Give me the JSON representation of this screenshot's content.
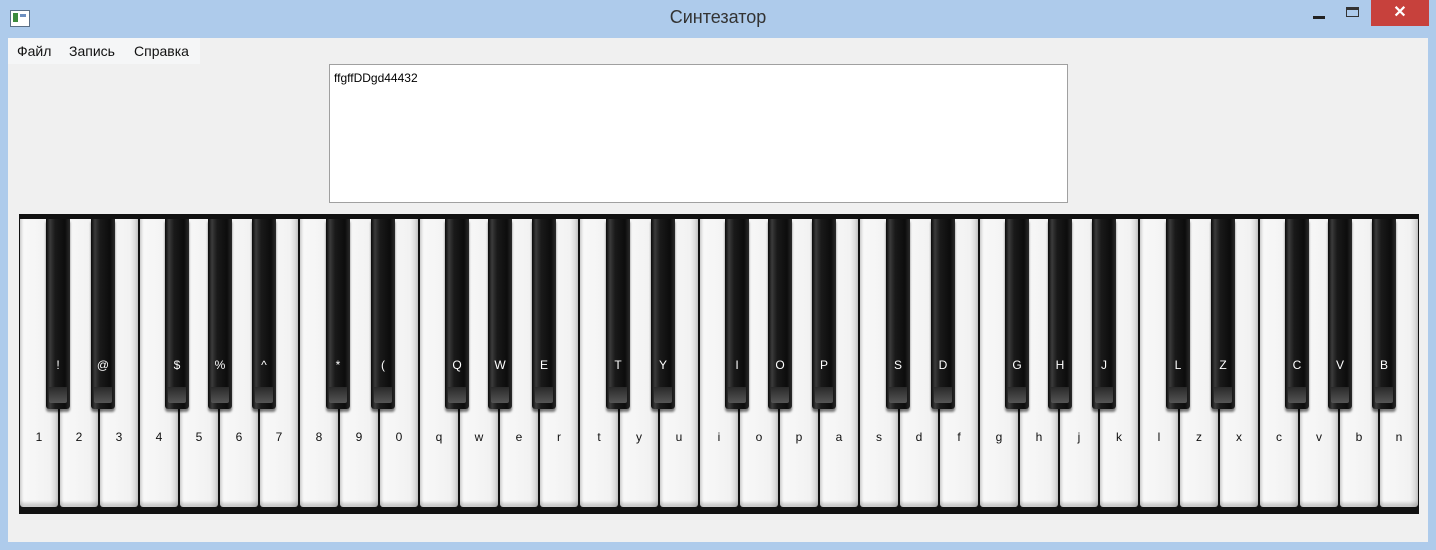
{
  "window": {
    "title": "Синтезатор",
    "close_glyph": "✕"
  },
  "menu": {
    "items": [
      "Файл",
      "Запись",
      "Справка"
    ]
  },
  "text_field": {
    "value": "ffgffDDgd44432"
  },
  "keyboard": {
    "white_labels": [
      "1",
      "2",
      "3",
      "4",
      "5",
      "6",
      "7",
      "8",
      "9",
      "0",
      "q",
      "w",
      "e",
      "r",
      "t",
      "y",
      "u",
      "i",
      "o",
      "p",
      "a",
      "s",
      "d",
      "f",
      "g",
      "h",
      "j",
      "k",
      "l",
      "z",
      "x",
      "c",
      "v",
      "b",
      "n"
    ],
    "black_labels": [
      "!",
      "@",
      "$",
      "%",
      "^",
      "*",
      "(",
      "Q",
      "W",
      "E",
      "T",
      "Y",
      "I",
      "O",
      "P",
      "S",
      "D",
      "G",
      "H",
      "J",
      "L",
      "Z",
      "C",
      "V",
      "B"
    ]
  },
  "colors": {
    "titlebar": "#aecbeb",
    "close_button": "#c7413c",
    "client_bg": "#f0f0f0"
  }
}
